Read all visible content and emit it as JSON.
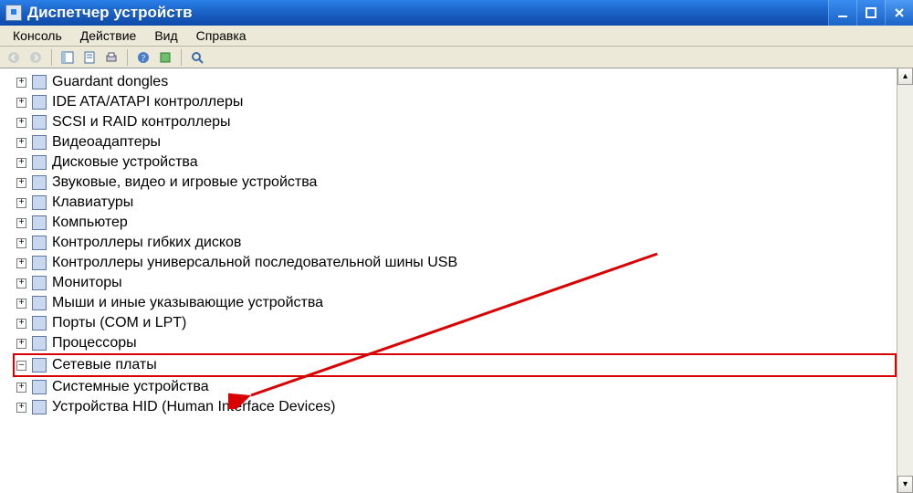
{
  "window": {
    "title": "Диспетчер устройств"
  },
  "menu": [
    "Консоль",
    "Действие",
    "Вид",
    "Справка"
  ],
  "tree": [
    {
      "label": "Guardant dongles",
      "icon": "guardant-icon",
      "highlighted": false
    },
    {
      "label": "IDE ATA/ATAPI контроллеры",
      "icon": "ide-icon",
      "highlighted": false
    },
    {
      "label": "SCSI и RAID контроллеры",
      "icon": "scsi-icon",
      "highlighted": false
    },
    {
      "label": "Видеоадаптеры",
      "icon": "display-icon",
      "highlighted": false
    },
    {
      "label": "Дисковые устройства",
      "icon": "disk-icon",
      "highlighted": false
    },
    {
      "label": "Звуковые, видео и игровые устройства",
      "icon": "sound-icon",
      "highlighted": false
    },
    {
      "label": "Клавиатуры",
      "icon": "keyboard-icon",
      "highlighted": false
    },
    {
      "label": "Компьютер",
      "icon": "computer-icon",
      "highlighted": false
    },
    {
      "label": "Контроллеры гибких дисков",
      "icon": "floppy-ctrl-icon",
      "highlighted": false
    },
    {
      "label": "Контроллеры универсальной последовательной шины USB",
      "icon": "usb-icon",
      "highlighted": false
    },
    {
      "label": "Мониторы",
      "icon": "monitor-icon",
      "highlighted": false
    },
    {
      "label": "Мыши и иные указывающие устройства",
      "icon": "mouse-icon",
      "highlighted": false
    },
    {
      "label": "Порты (COM и LPT)",
      "icon": "port-icon",
      "highlighted": false
    },
    {
      "label": "Процессоры",
      "icon": "cpu-icon",
      "highlighted": false
    },
    {
      "label": "Сетевые платы",
      "icon": "network-icon",
      "highlighted": true
    },
    {
      "label": "Системные устройства",
      "icon": "system-icon",
      "highlighted": false
    },
    {
      "label": "Устройства HID (Human Interface Devices)",
      "icon": "hid-icon",
      "highlighted": false
    }
  ]
}
